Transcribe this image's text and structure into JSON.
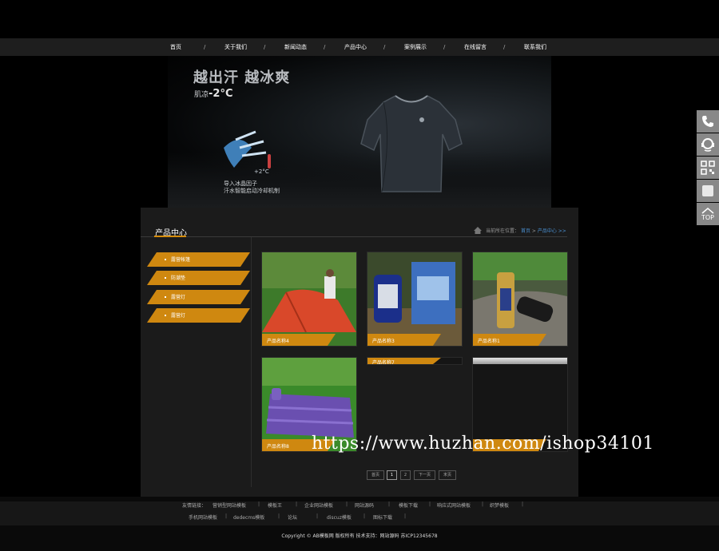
{
  "nav": {
    "items": [
      "首页",
      "关于我们",
      "新闻动态",
      "产品中心",
      "案例展示",
      "在线留言",
      "联系我们"
    ],
    "separator": "/"
  },
  "banner": {
    "headline": "越出汗 越冰爽",
    "temp_label": "肌凉",
    "temp_value": "-2°C",
    "icon_temp": "+2°C",
    "caption_line1": "导入冰晶因子",
    "caption_line2": "汗水智能启动冷却机制"
  },
  "section": {
    "title": "产品中心",
    "breadcrumb_prefix": "当前所在位置：",
    "breadcrumb_home": "首页",
    "breadcrumb_sep": ">",
    "breadcrumb_current": "产品中心 >>"
  },
  "sidebar": {
    "items": [
      {
        "label": "露营帐篷"
      },
      {
        "label": "防潮垫"
      },
      {
        "label": "露营灯"
      },
      {
        "label": "露营灯"
      }
    ]
  },
  "products": [
    {
      "name": "产品名称4"
    },
    {
      "name": "产品名称3"
    },
    {
      "name": "产品名称1"
    },
    {
      "name": "产品名称8"
    },
    {
      "name": "产品名称7"
    },
    {
      "name": ""
    }
  ],
  "pagination": {
    "first": "首页",
    "pages": [
      "1",
      "2"
    ],
    "current": "1",
    "next": "下一页",
    "last": "末页"
  },
  "footer": {
    "links_label": "友情链接：",
    "links_row1": [
      "营销型网站模板",
      "模板王",
      "企业网站模板",
      "网站源码",
      "模板下载",
      "响应式网站模板",
      "织梦模板"
    ],
    "links_row2": [
      "手机网站模板",
      "dedecms模板",
      "论坛",
      "discuz模板",
      "图标下载"
    ],
    "copyright": "Copyright © AB模板网 版权所有 技术支持：网站源码 苏ICP12345678"
  },
  "float_bar": {
    "items": [
      "phone-icon",
      "service-icon",
      "qrcode-icon",
      "message-icon",
      "top-icon"
    ],
    "top_label": "TOP"
  },
  "watermark": "https://www.huzhan.com/ishop34101",
  "colors": {
    "accent": "#cf8810",
    "background": "#000000",
    "panel": "#1b1b1b",
    "nav": "#1e1e1e",
    "float": "#888888",
    "link_blue": "#4a8fd0"
  }
}
